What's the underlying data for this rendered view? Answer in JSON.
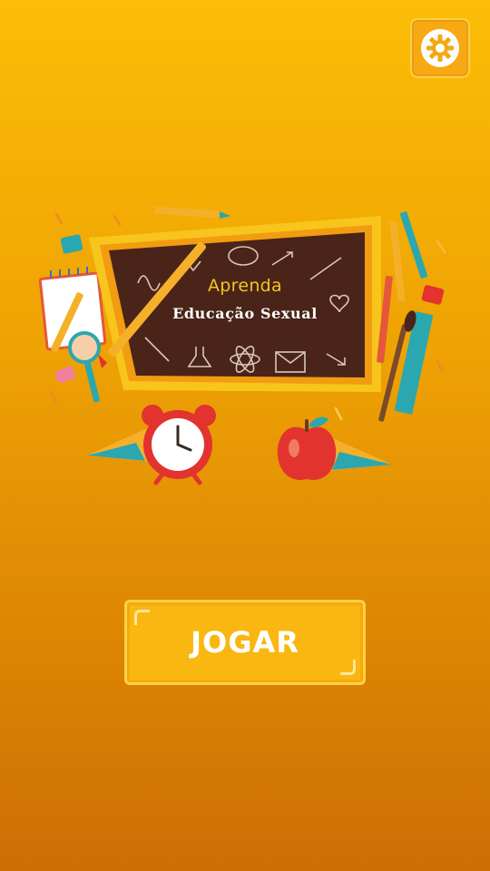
{
  "header": {
    "settings_icon": "gear-icon"
  },
  "hero": {
    "title_line1": "Aprenda",
    "title_line2": "Educação Sexual",
    "illustrations": [
      "chalkboard",
      "pencil-icon",
      "notepad-icon",
      "magnifier-icon",
      "ruler-icon",
      "paintbrush-icon",
      "alarm-clock-icon",
      "apple-icon",
      "paperclip-icon",
      "sharpener-icon"
    ]
  },
  "actions": {
    "play_label": "JOGAR"
  },
  "colors": {
    "background_top": "#fbbd05",
    "background_bottom": "#cd6e05",
    "board": "#4a2418",
    "board_frame": "#f7c51b",
    "button": "#fab711"
  }
}
